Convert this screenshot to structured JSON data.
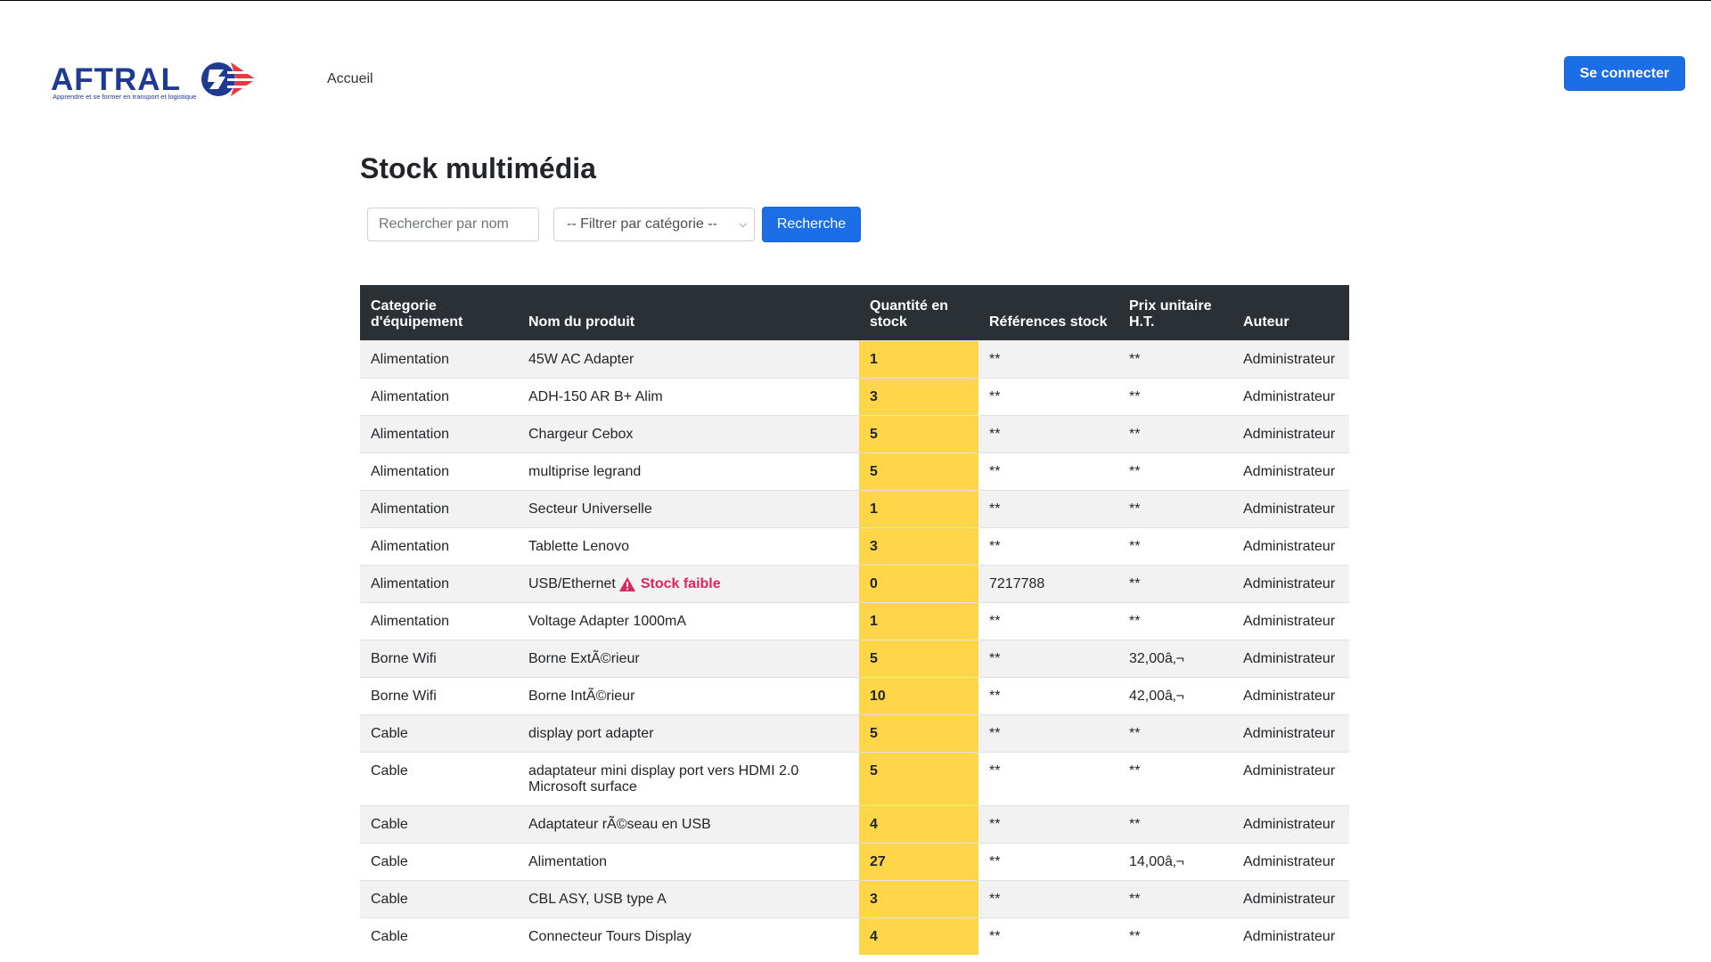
{
  "logo": {
    "word": "AFTRAL",
    "tagline": "Apprendre et se former en transport et logistique"
  },
  "nav": {
    "home": "Accueil"
  },
  "header": {
    "login_label": "Se connecter"
  },
  "page": {
    "title": "Stock multimédia"
  },
  "filters": {
    "search_placeholder": "Rechercher par nom",
    "category_selected": "-- Filtrer par catégorie --",
    "search_button": "Recherche"
  },
  "table": {
    "headers": [
      "Categorie d'équipement",
      "Nom du produit",
      "Quantité en stock",
      "Références stock",
      "Prix unitaire H.T.",
      "Auteur"
    ],
    "low_stock_label": "Stock faible",
    "rows": [
      {
        "category": "Alimentation",
        "name": "45W AC Adapter",
        "qty": "1",
        "ref": "**",
        "price": "**",
        "author": "Administrateur"
      },
      {
        "category": "Alimentation",
        "name": "ADH-150 AR B+ Alim",
        "qty": "3",
        "ref": "**",
        "price": "**",
        "author": "Administrateur"
      },
      {
        "category": "Alimentation",
        "name": "Chargeur Cebox",
        "qty": "5",
        "ref": "**",
        "price": "**",
        "author": "Administrateur"
      },
      {
        "category": "Alimentation",
        "name": "multiprise legrand",
        "qty": "5",
        "ref": "**",
        "price": "**",
        "author": "Administrateur"
      },
      {
        "category": "Alimentation",
        "name": "Secteur Universelle",
        "qty": "1",
        "ref": "**",
        "price": "**",
        "author": "Administrateur"
      },
      {
        "category": "Alimentation",
        "name": "Tablette Lenovo",
        "qty": "3",
        "ref": "**",
        "price": "**",
        "author": "Administrateur"
      },
      {
        "category": "Alimentation",
        "name": "USB/Ethernet",
        "qty": "0",
        "ref": "7217788",
        "price": "**",
        "author": "Administrateur",
        "low": true
      },
      {
        "category": "Alimentation",
        "name": "Voltage Adapter 1000mA",
        "qty": "1",
        "ref": "**",
        "price": "**",
        "author": "Administrateur"
      },
      {
        "category": "Borne Wifi",
        "name": "Borne ExtÃ©rieur",
        "qty": "5",
        "ref": "**",
        "price": "32,00â‚¬",
        "author": "Administrateur"
      },
      {
        "category": "Borne Wifi",
        "name": "Borne IntÃ©rieur",
        "qty": "10",
        "ref": "**",
        "price": "42,00â‚¬",
        "author": "Administrateur"
      },
      {
        "category": "Cable",
        "name": "display port adapter",
        "qty": "5",
        "ref": "**",
        "price": "**",
        "author": "Administrateur"
      },
      {
        "category": "Cable",
        "name": "adaptateur mini display port vers HDMI 2.0 Microsoft surface",
        "qty": "5",
        "ref": "**",
        "price": "**",
        "author": "Administrateur"
      },
      {
        "category": "Cable",
        "name": "Adaptateur rÃ©seau en USB",
        "qty": "4",
        "ref": "**",
        "price": "**",
        "author": "Administrateur"
      },
      {
        "category": "Cable",
        "name": "Alimentation",
        "qty": "27",
        "ref": "**",
        "price": "14,00â‚¬",
        "author": "Administrateur"
      },
      {
        "category": "Cable",
        "name": "CBL ASY, USB type A",
        "qty": "3",
        "ref": "**",
        "price": "**",
        "author": "Administrateur"
      },
      {
        "category": "Cable",
        "name": "Connecteur Tours Display",
        "qty": "4",
        "ref": "**",
        "price": "**",
        "author": "Administrateur"
      }
    ]
  },
  "colors": {
    "primary": "#1b6ee5",
    "header_bg": "#2b3035",
    "qty_highlight": "#ffd54a",
    "low_stock": "#e0245e",
    "logo_blue": "#1f3a93",
    "logo_red": "#e63946"
  }
}
